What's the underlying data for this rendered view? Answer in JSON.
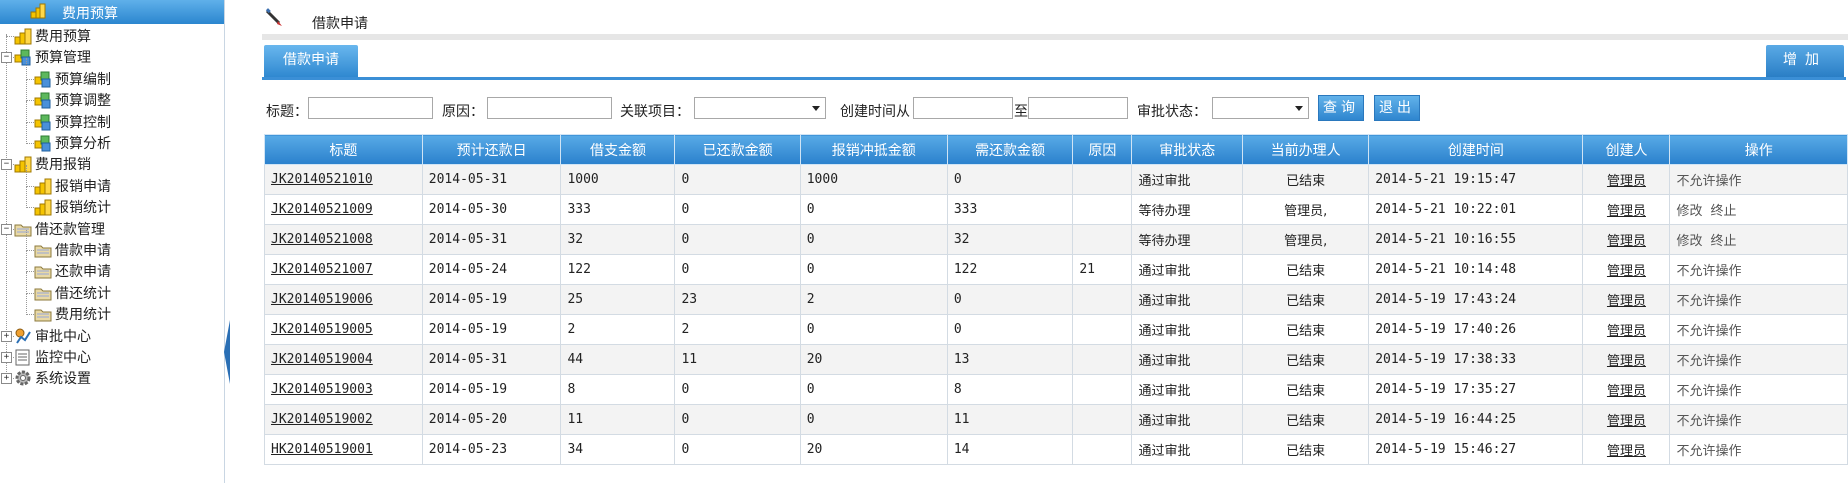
{
  "sidebar": {
    "header": "费用预算",
    "tree": [
      {
        "label": "费用预算",
        "level": 0,
        "icon": "coins-icon",
        "toggle": ""
      },
      {
        "label": "预算管理",
        "level": 0,
        "icon": "module-icon",
        "toggle": "−"
      },
      {
        "label": "预算编制",
        "level": 1,
        "icon": "module-icon",
        "toggle": ""
      },
      {
        "label": "预算调整",
        "level": 1,
        "icon": "module-icon",
        "toggle": ""
      },
      {
        "label": "预算控制",
        "level": 1,
        "icon": "module-icon",
        "toggle": ""
      },
      {
        "label": "预算分析",
        "level": 1,
        "icon": "module-icon",
        "toggle": ""
      },
      {
        "label": "费用报销",
        "level": 0,
        "icon": "coins-icon",
        "toggle": "−"
      },
      {
        "label": "报销申请",
        "level": 1,
        "icon": "coins-icon",
        "toggle": ""
      },
      {
        "label": "报销统计",
        "level": 1,
        "icon": "coins-icon",
        "toggle": ""
      },
      {
        "label": "借还款管理",
        "level": 0,
        "icon": "folder-icon",
        "toggle": "−"
      },
      {
        "label": "借款申请",
        "level": 1,
        "icon": "folder-icon",
        "toggle": ""
      },
      {
        "label": "还款申请",
        "level": 1,
        "icon": "folder-icon",
        "toggle": ""
      },
      {
        "label": "借还统计",
        "level": 1,
        "icon": "folder-icon",
        "toggle": ""
      },
      {
        "label": "费用统计",
        "level": 1,
        "icon": "folder-icon",
        "toggle": ""
      },
      {
        "label": "审批中心",
        "level": 0,
        "icon": "approve-icon",
        "toggle": "+"
      },
      {
        "label": "监控中心",
        "level": 0,
        "icon": "monitor-icon",
        "toggle": "+"
      },
      {
        "label": "系统设置",
        "level": 0,
        "icon": "gear-icon",
        "toggle": "+"
      }
    ]
  },
  "page": {
    "title": "借款申请",
    "tab": "借款申请",
    "add_button": "增加"
  },
  "filters": {
    "title_label": "标题：",
    "reason_label": "原因：",
    "project_label": "关联项目：",
    "created_from_label": "创建时间从",
    "to_label": "至",
    "status_label": "审批状态：",
    "query_button": "查询",
    "exit_button": "退出"
  },
  "table": {
    "columns": [
      "标题",
      "预计还款日",
      "借支金额",
      "已还款金额",
      "报销冲抵金额",
      "需还款金额",
      "原因",
      "审批状态",
      "当前办理人",
      "创建时间",
      "创建人",
      "操作"
    ],
    "rows": [
      {
        "title": "JK20140521010",
        "due": "2014-05-31",
        "borrow": "1000",
        "repaid": "0",
        "offset": "1000",
        "owed": "0",
        "reason": "",
        "status": "通过审批",
        "handler": "已结束",
        "created": "2014-5-21 19:15:47",
        "creator": "管理员",
        "ops": [
          "不允许操作"
        ]
      },
      {
        "title": "JK20140521009",
        "due": "2014-05-30",
        "borrow": "333",
        "repaid": "0",
        "offset": "0",
        "owed": "333",
        "reason": "",
        "status": "等待办理",
        "handler": "管理员,",
        "created": "2014-5-21 10:22:01",
        "creator": "管理员",
        "ops": [
          "修改",
          "终止"
        ]
      },
      {
        "title": "JK20140521008",
        "due": "2014-05-31",
        "borrow": "32",
        "repaid": "0",
        "offset": "0",
        "owed": "32",
        "reason": "",
        "status": "等待办理",
        "handler": "管理员,",
        "created": "2014-5-21 10:16:55",
        "creator": "管理员",
        "ops": [
          "修改",
          "终止"
        ]
      },
      {
        "title": "JK20140521007",
        "due": "2014-05-24",
        "borrow": "122",
        "repaid": "0",
        "offset": "0",
        "owed": "122",
        "reason": "21",
        "status": "通过审批",
        "handler": "已结束",
        "created": "2014-5-21 10:14:48",
        "creator": "管理员",
        "ops": [
          "不允许操作"
        ]
      },
      {
        "title": "JK20140519006",
        "due": "2014-05-19",
        "borrow": "25",
        "repaid": "23",
        "offset": "2",
        "owed": "0",
        "reason": "",
        "status": "通过审批",
        "handler": "已结束",
        "created": "2014-5-19 17:43:24",
        "creator": "管理员",
        "ops": [
          "不允许操作"
        ]
      },
      {
        "title": "JK20140519005",
        "due": "2014-05-19",
        "borrow": "2",
        "repaid": "2",
        "offset": "0",
        "owed": "0",
        "reason": "",
        "status": "通过审批",
        "handler": "已结束",
        "created": "2014-5-19 17:40:26",
        "creator": "管理员",
        "ops": [
          "不允许操作"
        ]
      },
      {
        "title": "JK20140519004",
        "due": "2014-05-31",
        "borrow": "44",
        "repaid": "11",
        "offset": "20",
        "owed": "13",
        "reason": "",
        "status": "通过审批",
        "handler": "已结束",
        "created": "2014-5-19 17:38:33",
        "creator": "管理员",
        "ops": [
          "不允许操作"
        ]
      },
      {
        "title": "JK20140519003",
        "due": "2014-05-19",
        "borrow": "8",
        "repaid": "0",
        "offset": "0",
        "owed": "8",
        "reason": "",
        "status": "通过审批",
        "handler": "已结束",
        "created": "2014-5-19 17:35:27",
        "creator": "管理员",
        "ops": [
          "不允许操作"
        ]
      },
      {
        "title": "JK20140519002",
        "due": "2014-05-20",
        "borrow": "11",
        "repaid": "0",
        "offset": "0",
        "owed": "11",
        "reason": "",
        "status": "通过审批",
        "handler": "已结束",
        "created": "2014-5-19 16:44:25",
        "creator": "管理员",
        "ops": [
          "不允许操作"
        ]
      },
      {
        "title": "HK20140519001",
        "due": "2014-05-23",
        "borrow": "34",
        "repaid": "0",
        "offset": "20",
        "owed": "14",
        "reason": "",
        "status": "通过审批",
        "handler": "已结束",
        "created": "2014-5-19 15:46:27",
        "creator": "管理员",
        "ops": [
          "不允许操作"
        ]
      }
    ]
  },
  "colors": {
    "header_blue": "#2a80cc",
    "row_alt": "#f3f3f3",
    "coin_gold": "#e8b400"
  }
}
